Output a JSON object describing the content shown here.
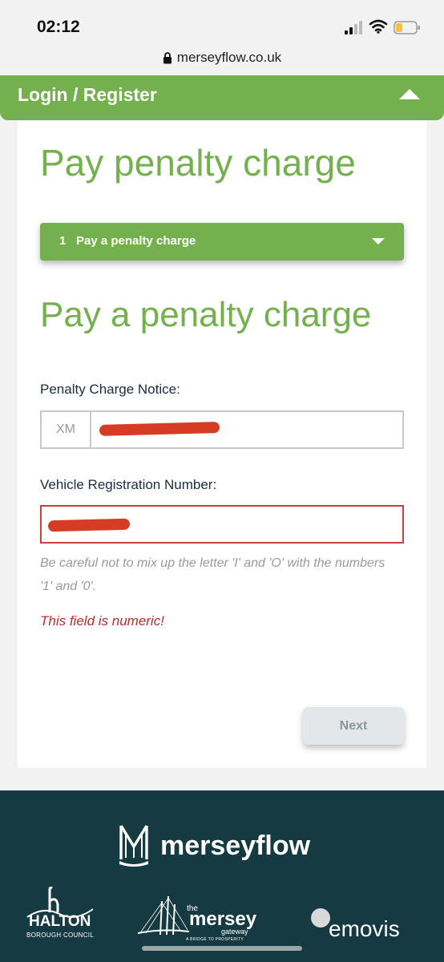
{
  "status": {
    "time": "02:12",
    "battery_color": "#f5c342"
  },
  "browser": {
    "url": "merseyflow.co.uk"
  },
  "nav": {
    "login_label": "Login / Register"
  },
  "main": {
    "page_title": "Pay penalty charge",
    "step": {
      "number": "1",
      "label": "Pay a penalty charge"
    },
    "section_title": "Pay a penalty charge",
    "pcn": {
      "label": "Penalty Charge Notice:",
      "prefix": "XM",
      "value_redacted": true
    },
    "vrn": {
      "label": "Vehicle Registration Number:",
      "value_redacted": true
    },
    "helper_text": "Be careful not to mix up the letter 'I' and 'O' with the numbers '1' and '0'.",
    "error_text": "This field is numeric!",
    "next_label": "Next"
  },
  "footer": {
    "brand": "merseyflow",
    "halton": {
      "name": "HALTON",
      "sub": "BOROUGH COUNCIL"
    },
    "gateway": {
      "the": "the",
      "name": "mersey",
      "word": "gateway",
      "tagline": "A BRIDGE TO PROSPERITY"
    },
    "emovis": "emovis"
  },
  "colors": {
    "brand_green": "#74b04e",
    "footer_bg": "#153a42",
    "error_red": "#c0282a",
    "redaction": "#d63b24"
  }
}
